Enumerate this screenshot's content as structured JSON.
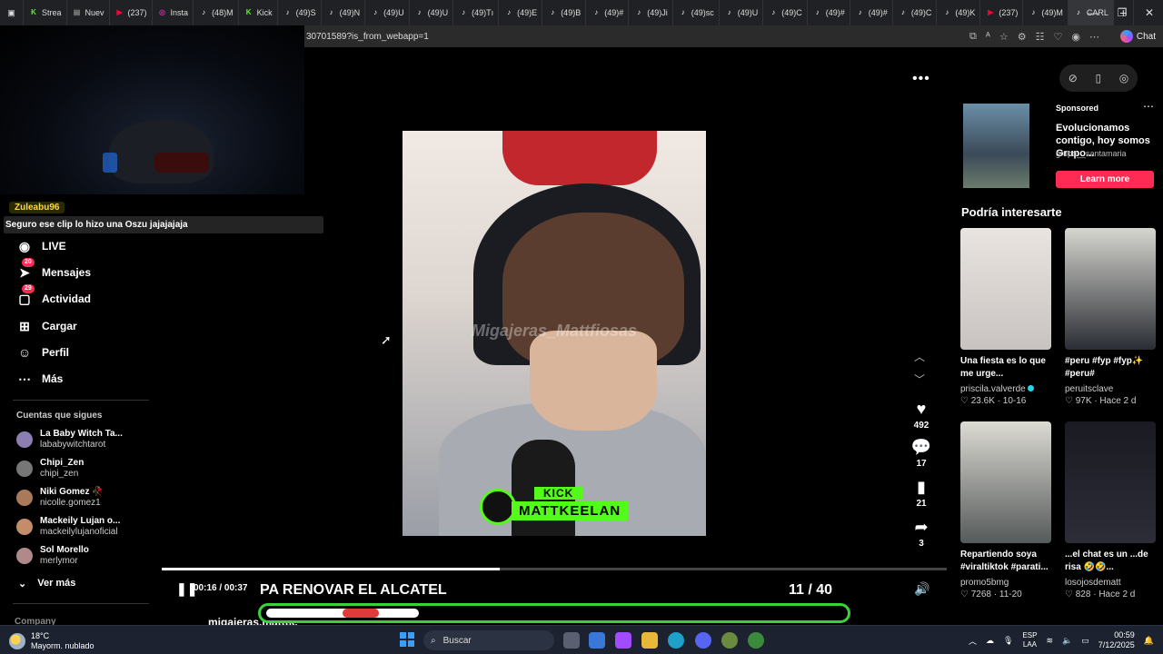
{
  "browser": {
    "tabs": [
      {
        "label": "Strea",
        "icon": "kick-icon",
        "color": "#53fc18"
      },
      {
        "label": "Nuev",
        "icon": "newtab-icon",
        "color": "#888888"
      },
      {
        "label": "(237)",
        "icon": "youtube-icon",
        "color": "#ff0033"
      },
      {
        "label": "Insta",
        "icon": "instagram-icon",
        "color": "#d6249f"
      },
      {
        "label": "(48)M",
        "icon": "tiktok-icon",
        "color": "#ffffff"
      },
      {
        "label": "Kick",
        "icon": "kick-icon",
        "color": "#53fc18"
      },
      {
        "label": "(49)S",
        "icon": "tiktok-icon",
        "color": "#ffffff"
      },
      {
        "label": "(49)N",
        "icon": "tiktok-icon",
        "color": "#ffffff"
      },
      {
        "label": "(49)U",
        "icon": "tiktok-icon",
        "color": "#ffffff"
      },
      {
        "label": "(49)U",
        "icon": "tiktok-icon",
        "color": "#ffffff"
      },
      {
        "label": "(49)Tı",
        "icon": "tiktok-icon",
        "color": "#ffffff"
      },
      {
        "label": "(49)E",
        "icon": "tiktok-icon",
        "color": "#ffffff"
      },
      {
        "label": "(49)B",
        "icon": "tiktok-icon",
        "color": "#ffffff"
      },
      {
        "label": "(49)#",
        "icon": "tiktok-icon",
        "color": "#ffffff"
      },
      {
        "label": "(49)Ji",
        "icon": "tiktok-icon",
        "color": "#ffffff"
      },
      {
        "label": "(49)sc",
        "icon": "tiktok-icon",
        "color": "#ffffff"
      },
      {
        "label": "(49)U",
        "icon": "tiktok-icon",
        "color": "#ffffff"
      },
      {
        "label": "(49)C",
        "icon": "tiktok-icon",
        "color": "#ffffff"
      },
      {
        "label": "(49)#",
        "icon": "tiktok-icon",
        "color": "#ffffff"
      },
      {
        "label": "(49)#",
        "icon": "tiktok-icon",
        "color": "#ffffff"
      },
      {
        "label": "(49)C",
        "icon": "tiktok-icon",
        "color": "#ffffff"
      },
      {
        "label": "(49)K",
        "icon": "tiktok-icon",
        "color": "#ffffff"
      },
      {
        "label": "(237)",
        "icon": "youtube-icon",
        "color": "#ff0033"
      },
      {
        "label": "(49)M",
        "icon": "tiktok-icon",
        "color": "#ffffff"
      },
      {
        "label": "CARL",
        "icon": "tiktok-icon",
        "color": "#ffffff"
      }
    ],
    "url": "30701589?is_from_webapp=1",
    "chat_label": "Chat"
  },
  "chat_overlay": {
    "user": "Zuleabu96",
    "message": "Seguro ese clip lo hizo una Oszu jajajajaja"
  },
  "sidebar": {
    "items": [
      {
        "label": "LIVE",
        "icon": "live-icon",
        "badge": ""
      },
      {
        "label": "Mensajes",
        "icon": "send-icon",
        "badge": "20"
      },
      {
        "label": "Actividad",
        "icon": "inbox-icon",
        "badge": "29"
      },
      {
        "label": "Cargar",
        "icon": "upload-icon",
        "badge": ""
      },
      {
        "label": "Perfil",
        "icon": "profile-icon",
        "badge": ""
      },
      {
        "label": "Más",
        "icon": "more-icon",
        "badge": ""
      }
    ],
    "following_title": "Cuentas que sigues",
    "following": [
      {
        "name": "La Baby Witch Ta...",
        "handle": "lababywitchtarot",
        "color": "#8a7fb0"
      },
      {
        "name": "Chipi_Zen",
        "handle": "chipi_zen",
        "color": "#777777"
      },
      {
        "name": "Niki Gomez 🥀",
        "handle": "nicolle.gomez1",
        "color": "#a87a5a"
      },
      {
        "name": "Mackeily Lujan o...",
        "handle": "mackeilylujanoficial",
        "color": "#c48d6a"
      },
      {
        "name": "Sol Morello",
        "handle": "merlymor",
        "color": "#b08a8a"
      }
    ],
    "see_more": "Ver más",
    "company": "Company"
  },
  "video": {
    "watermark": "Migajeras_Mattfiosas",
    "kick_label": "KICK",
    "kick_name": "MATTKEELAN",
    "time": "00:16 / 00:37",
    "progress": 0.43,
    "caption": "PA RENOVAR EL ALCATEL",
    "counter": "11  / 40",
    "author": "migajeras.matttie"
  },
  "actions": {
    "likes": "492",
    "comments": "17",
    "saves": "21",
    "shares": "3"
  },
  "ad": {
    "sponsored": "Sponsored",
    "title": "Evolucionamos contigo, hoy somos Grupo...",
    "handle": "grupo__santamaria",
    "cta": "Learn more"
  },
  "recommendations": {
    "heading": "Podría interesarte",
    "items": [
      {
        "title": "Una fiesta es lo que me urge...",
        "user": "priscila.valverde",
        "verified": true,
        "stats": "♡ 23.6K · 10-16",
        "colors": [
          "#e9e4e0",
          "#c8c3c0"
        ]
      },
      {
        "title": "#peru #fyp #fyp✨ #peru#",
        "user": "peruitsclave",
        "verified": false,
        "stats": "♡ 97K · Hace 2 d",
        "colors": [
          "#d6d6d0",
          "#2a2d33"
        ]
      },
      {
        "title": "Repartiendo soya #viraltiktok #parati...",
        "user": "promo5bmg",
        "verified": false,
        "stats": "♡ 7268 · 11-20",
        "colors": [
          "#dcdad3",
          "#555a5a"
        ]
      },
      {
        "title": "...el chat es un ...de risa 🤣🤣...",
        "user": "losojosdematt",
        "verified": false,
        "stats": "♡ 828 · Hace 2 d",
        "colors": [
          "#1a1a22",
          "#2d2d38"
        ]
      }
    ]
  },
  "taskbar": {
    "temp": "18°C",
    "weather": "Mayorm. nublado",
    "search": "Buscar",
    "lang_top": "ESP",
    "lang_bottom": "LAA",
    "time": "00:59",
    "date": "7/12/2025"
  }
}
